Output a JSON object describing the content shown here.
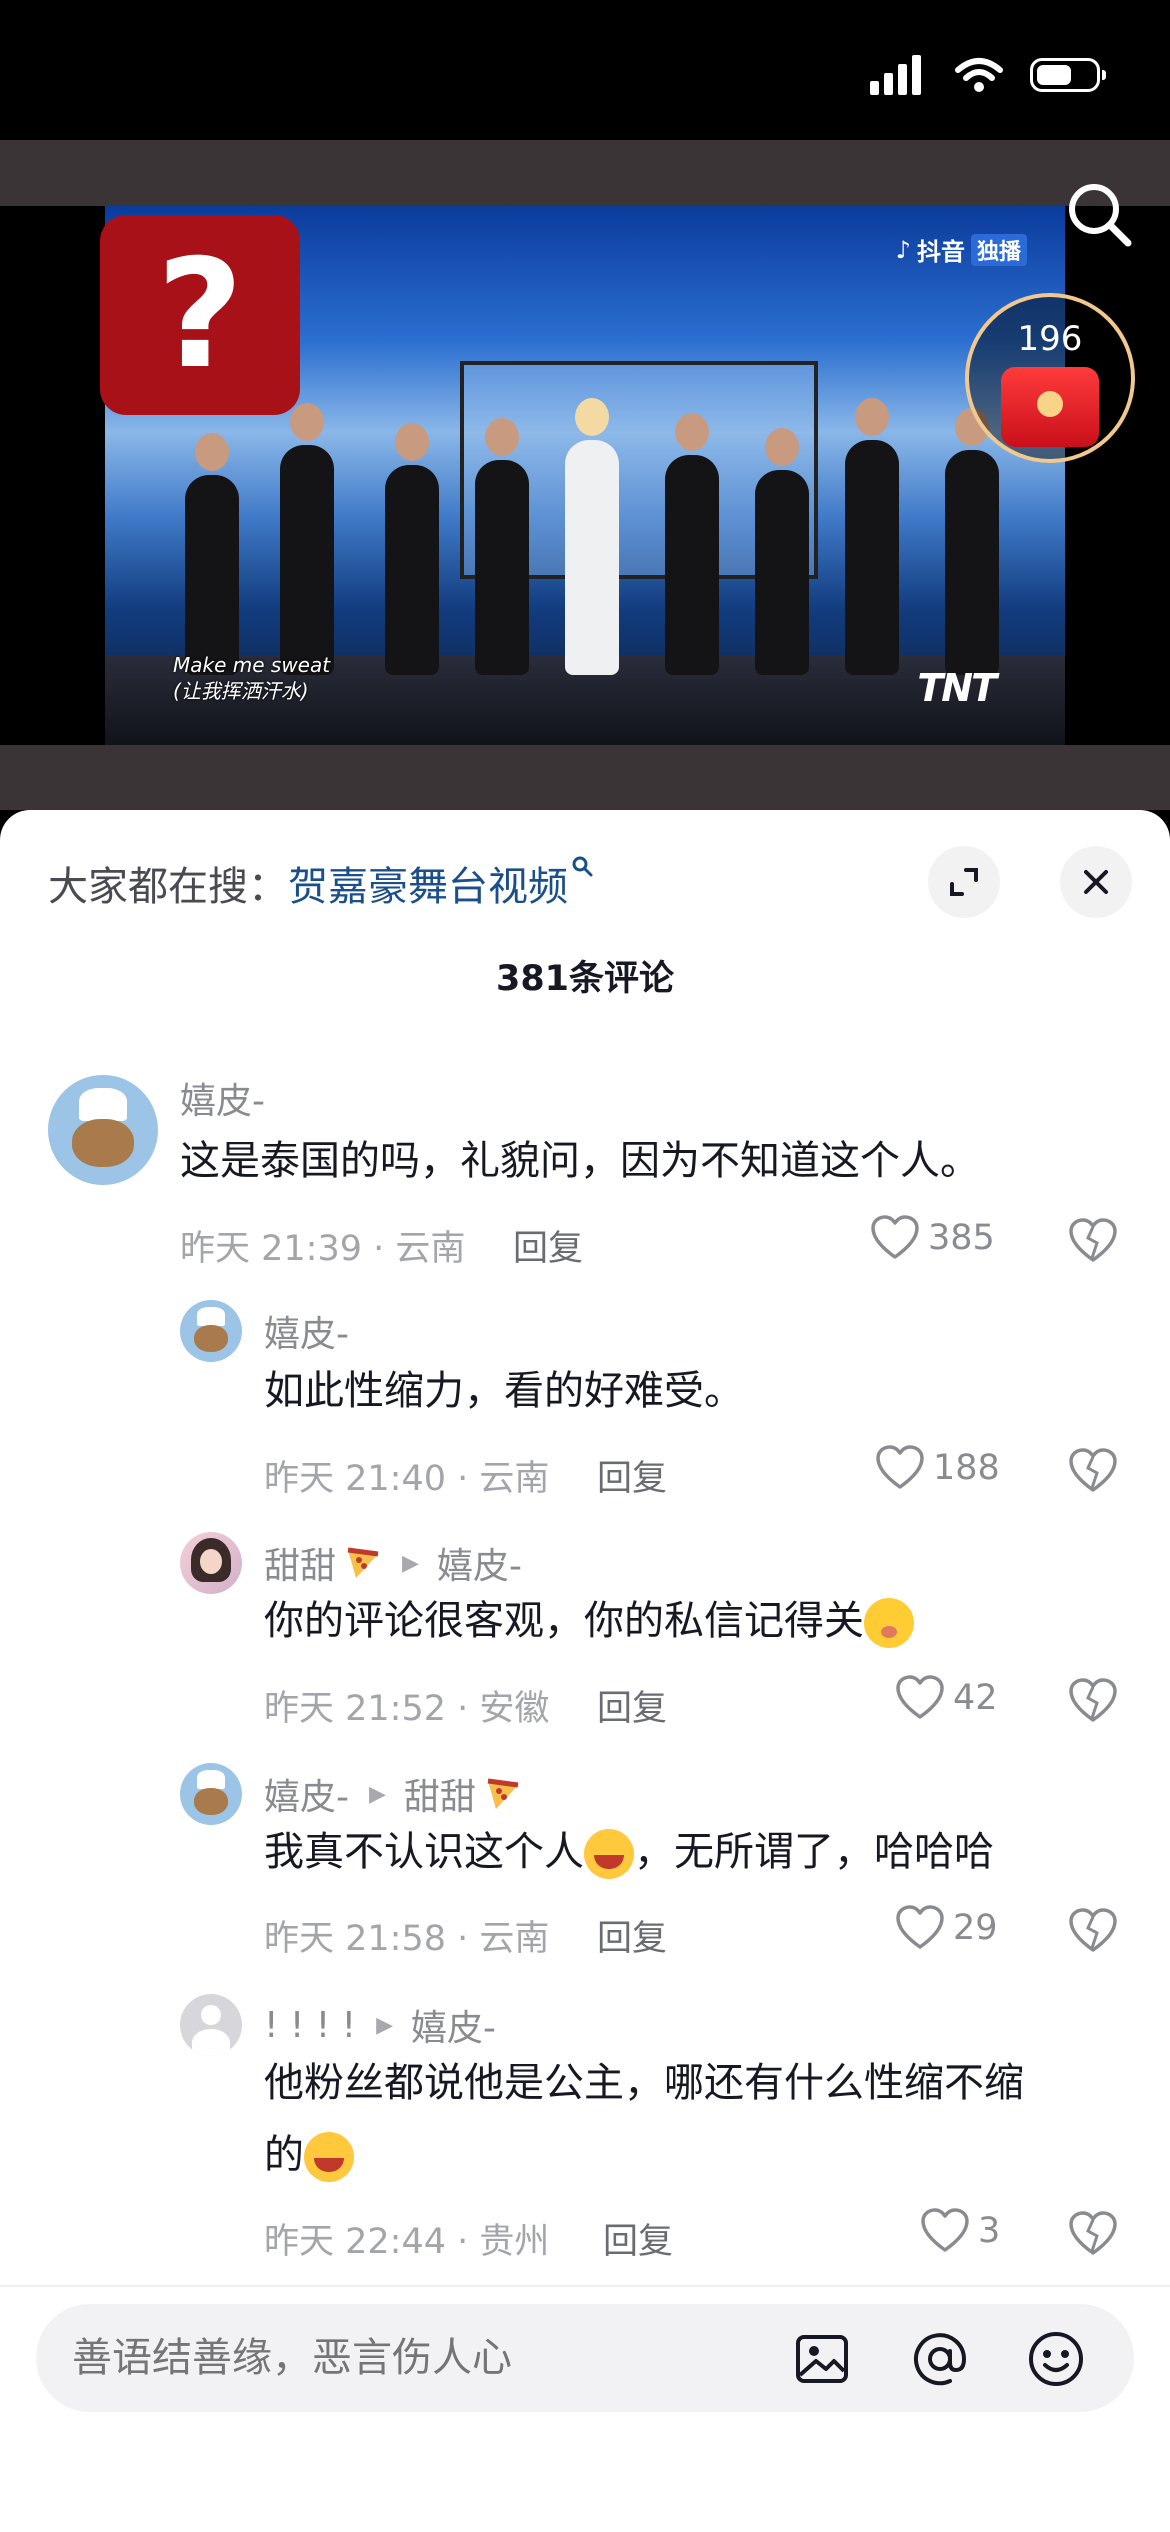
{
  "video": {
    "watermark": "抖音",
    "watermark_badge": "独播",
    "subtitle_en": "Make me sweat",
    "subtitle_cn": "(让我挥洒汗水)",
    "channel_logo": "TNT",
    "badge_symbol": "?",
    "redpacket_count": "196"
  },
  "sheet": {
    "search_prefix": "大家都在搜：",
    "search_query": "贺嘉豪舞台视频",
    "comment_count": "381条评论"
  },
  "comments": [
    {
      "nick": "嬉皮-",
      "text": "这是泰国的吗，礼貌问，因为不知道这个人。",
      "meta": "昨天 21:39 · 云南",
      "reply": "回复",
      "likes": "385"
    },
    {
      "nick": "嬉皮-",
      "text": "如此性缩力，看的好难受。",
      "meta": "昨天 21:40 · 云南",
      "reply": "回复",
      "likes": "188"
    },
    {
      "nick": "甜甜",
      "reply_to": "嬉皮-",
      "text": "你的评论很客观，你的私信记得关",
      "meta": "昨天 21:52 · 安徽",
      "reply": "回复",
      "likes": "42"
    },
    {
      "nick": "嬉皮-",
      "reply_to": "甜甜",
      "text_a": "我真不认识这个人",
      "text_b": "，无所谓了，哈哈哈",
      "meta": "昨天 21:58 · 云南",
      "reply": "回复",
      "likes": "29"
    },
    {
      "nick": "! ! ! !",
      "reply_to": "嬉皮-",
      "text_line1": "他粉丝都说他是公主，哪还有什么性缩不缩",
      "text_line2": "的",
      "meta": "昨天 22:44 · 贵州",
      "reply": "回复",
      "likes": "3"
    }
  ],
  "input": {
    "placeholder": "善语结善缘，恶言伤人心"
  },
  "colors": {
    "accent_link": "#1a4f8c",
    "redpacket": "#d7141d",
    "badge_red": "#a91119"
  }
}
